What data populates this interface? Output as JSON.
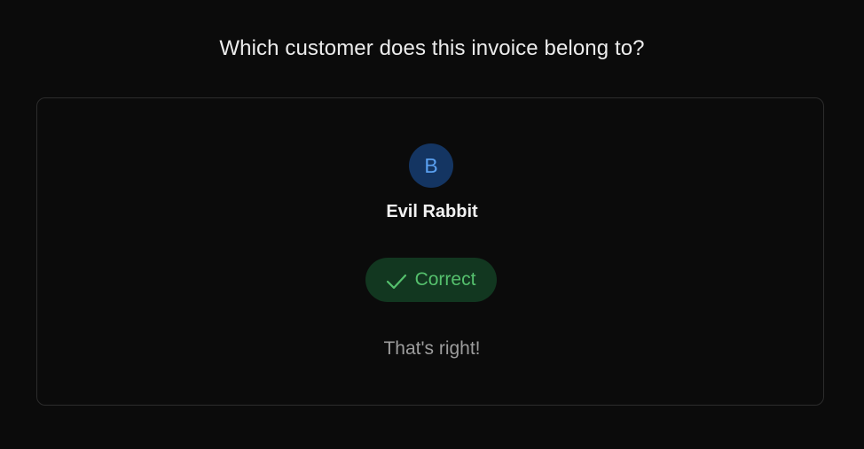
{
  "prompt": {
    "question": "Which customer does this invoice belong to?"
  },
  "customer": {
    "initial": "B",
    "name": "Evil Rabbit"
  },
  "result": {
    "status_label": "Correct",
    "status_icon": "check-icon",
    "feedback": "That's right!"
  },
  "colors": {
    "background": "#0b0b0b",
    "card_border": "#2c2c2c",
    "avatar_bg": "#143562",
    "avatar_text": "#5aa0f0",
    "success_bg": "#123720",
    "success_text": "#55c06d",
    "muted_text": "#9d9d9d"
  }
}
